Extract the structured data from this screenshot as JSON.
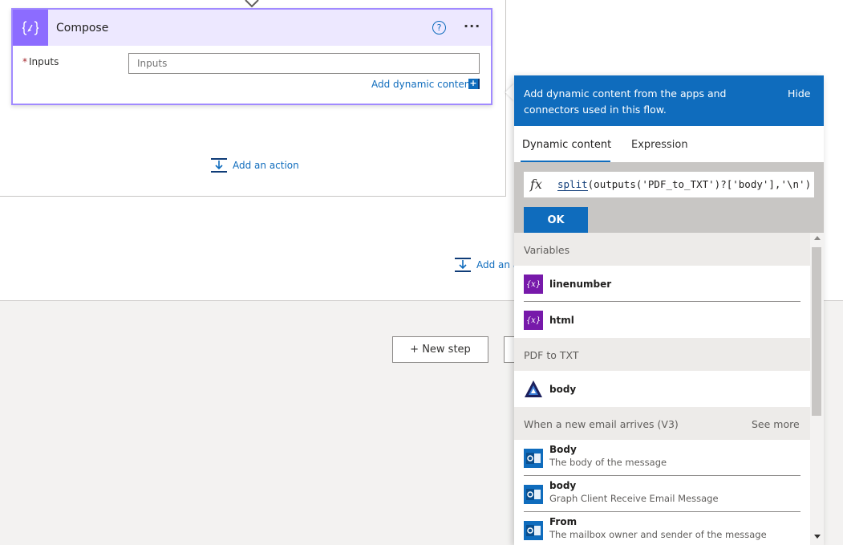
{
  "compose": {
    "title": "Compose",
    "help_icon": "?",
    "more_icon": "···",
    "inputs_required_marker": "*",
    "inputs_label": "Inputs",
    "inputs_placeholder": "Inputs",
    "add_dynamic_label": "Add dynamic content",
    "add_dynamic_icon": "+"
  },
  "canvas": {
    "add_action_label": "Add an action",
    "add_action_label_2": "Add an a",
    "new_step_label": "+ New step"
  },
  "panel": {
    "header_text": "Add dynamic content from the apps and connectors used in this flow.",
    "hide_label": "Hide",
    "tabs": [
      {
        "label": "Dynamic content",
        "active": true
      },
      {
        "label": "Expression",
        "active": false
      }
    ],
    "expression": {
      "fx_icon": "fx",
      "function_name": "split",
      "rest": "(outputs('PDF_to_TXT')?['body'],'\\n')"
    },
    "ok_label": "OK",
    "sections": [
      {
        "title": "Variables",
        "see_more": "",
        "items": [
          {
            "name": "linenumber",
            "description": "",
            "icon": "variable-icon"
          },
          {
            "name": "html",
            "description": "",
            "icon": "variable-icon"
          }
        ]
      },
      {
        "title": "PDF to TXT",
        "see_more": "",
        "items": [
          {
            "name": "body",
            "description": "",
            "icon": "pdf-connector-icon"
          }
        ]
      },
      {
        "title": "When a new email arrives (V3)",
        "see_more": "See more",
        "items": [
          {
            "name": "Body",
            "description": "The body of the message",
            "icon": "outlook-icon"
          },
          {
            "name": "body",
            "description": "Graph Client Receive Email Message",
            "icon": "outlook-icon"
          },
          {
            "name": "From",
            "description": "The mailbox owner and sender of the message",
            "icon": "outlook-icon"
          }
        ]
      }
    ],
    "variable_icon_glyph": "{x}"
  },
  "colors": {
    "accent_blue": "#0f6cbd",
    "compose_purple": "#8c6cff",
    "compose_header": "#ede8ff",
    "variable_purple": "#7719aa"
  }
}
